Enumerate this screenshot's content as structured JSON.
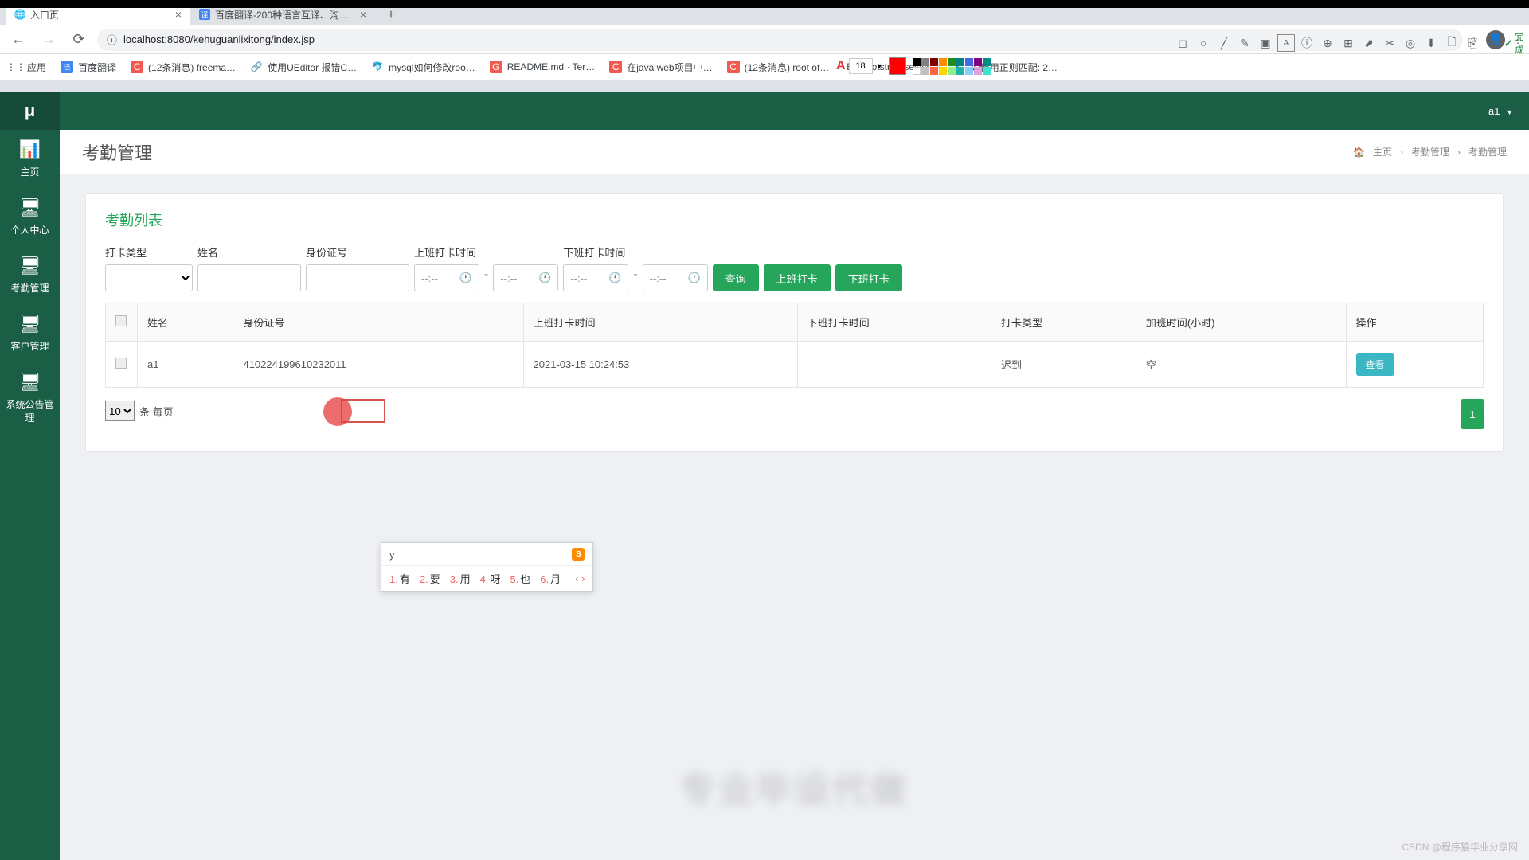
{
  "browser": {
    "tabs": [
      {
        "title": "入口页",
        "favicon": "🌐"
      },
      {
        "title": "百度翻译-200种语言互译、沟通…",
        "favicon": "译"
      }
    ],
    "url": "localhost:8080/kehuguanlixitong/index.jsp",
    "url_prefix_icon": "ⓘ",
    "done_label": "完成",
    "font_size": "18",
    "bookmarks": [
      {
        "icon": "⋮⋮",
        "label": "应用"
      },
      {
        "icon": "译",
        "label": "百度翻译",
        "cls": "blue"
      },
      {
        "icon": "C",
        "label": "(12条消息) freema…",
        "cls": "red"
      },
      {
        "icon": "🔗",
        "label": "使用UEditor 报错C…"
      },
      {
        "icon": "🐬",
        "label": "mysql如何修改roo…"
      },
      {
        "icon": "G",
        "label": "README.md · Ter…",
        "cls": "red"
      },
      {
        "icon": "C",
        "label": "在java web项目中…",
        "cls": "red"
      },
      {
        "icon": "C",
        "label": "(12条消息) root of…",
        "cls": "red"
      },
      {
        "icon": "B",
        "label": "bootstrap-select…"
      },
      {
        "icon": "🐾",
        "label": "如何用正则匹配:  2…"
      }
    ]
  },
  "sidebar": {
    "logo": "μ",
    "items": [
      {
        "icon": "📊",
        "label": "主页"
      },
      {
        "icon": "🖥",
        "label": "个人中心"
      },
      {
        "icon": "🖥",
        "label": "考勤管理"
      },
      {
        "icon": "🖥",
        "label": "客户管理"
      },
      {
        "icon": "🖥",
        "label": "系统公告管理"
      }
    ]
  },
  "topbar": {
    "user": "a1"
  },
  "page": {
    "title": "考勤管理",
    "crumb_home": "主页",
    "crumb_mid": "考勤管理",
    "crumb_leaf": "考勤管理"
  },
  "card": {
    "title": "考勤列表",
    "filters": {
      "type_label": "打卡类型",
      "name_label": "姓名",
      "id_label": "身份证号",
      "on_label": "上班打卡时间",
      "off_label": "下班打卡时间",
      "time_placeholder": "--:--",
      "search_btn": "查询",
      "on_btn": "上班打卡",
      "off_btn": "下班打卡"
    },
    "columns": [
      "",
      "姓名",
      "身份证号",
      "上班打卡时间",
      "下班打卡时间",
      "打卡类型",
      "加班时间(小时)",
      "操作"
    ],
    "rows": [
      {
        "name": "a1",
        "idno": "410224199610232011",
        "on": "2021-03-15 10:24:53",
        "off": "",
        "type": "迟到",
        "ot": "空",
        "view": "查看"
      }
    ],
    "per_page_value": "10",
    "per_page_label": "条 每页",
    "page_current": "1"
  },
  "ime": {
    "input": "y",
    "candidates": [
      "有",
      "要",
      "用",
      "呀",
      "也",
      "月"
    ]
  },
  "watermark": "专业毕设代做",
  "csdn": "CSDN @程序猿毕业分享网"
}
